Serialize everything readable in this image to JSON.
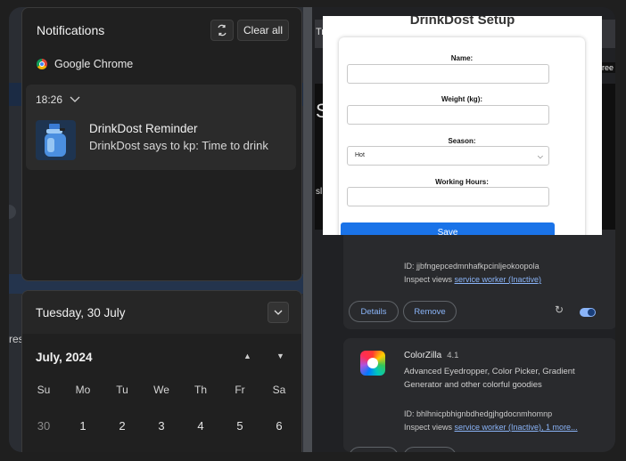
{
  "notifications": {
    "title": "Notifications",
    "clear_all_label": "Clear all",
    "app_name": "Google Chrome",
    "time": "18:26",
    "card_title": "DrinkDost Reminder",
    "card_body": "DrinkDost says to kp: Time to drink"
  },
  "calendar": {
    "date_header": "Tuesday, 30 July",
    "month_label": "July, 2024",
    "weekdays": [
      "Su",
      "Mo",
      "Tu",
      "We",
      "Th",
      "Fr",
      "Sa"
    ],
    "first_week": [
      "30",
      "1",
      "2",
      "3",
      "4",
      "5",
      "6"
    ]
  },
  "background": {
    "left_text": "res",
    "tab_text": "Tr",
    "big_letter": "S",
    "small_text": "sl",
    "for_free_text": "or free"
  },
  "popup": {
    "title": "DrinkDost Setup",
    "name_label": "Name:",
    "weight_label": "Weight (kg):",
    "season_label": "Season:",
    "season_value": "Hot",
    "hours_label": "Working Hours:",
    "save_label": "Save"
  },
  "extensions": [
    {
      "id_text": "ID: jjbfngepcedmnhafkpcinljeokoopola",
      "inspect_text": "Inspect views ",
      "inspect_link": "service worker (Inactive)",
      "details_label": "Details",
      "remove_label": "Remove",
      "enabled": true
    },
    {
      "name": "ColorZilla",
      "version": "4.1",
      "description": "Advanced Eyedropper, Color Picker, Gradient Generator and other colorful goodies",
      "id_text": "ID: bhlhnicpbhignbdhedgjhgdocnmhomnp",
      "inspect_text": "Inspect views ",
      "inspect_link": "service worker (Inactive), 1 more..."
    }
  ],
  "colors": {
    "accent": "#1a73e8",
    "link": "#8ab4f8",
    "panel": "#202020"
  }
}
